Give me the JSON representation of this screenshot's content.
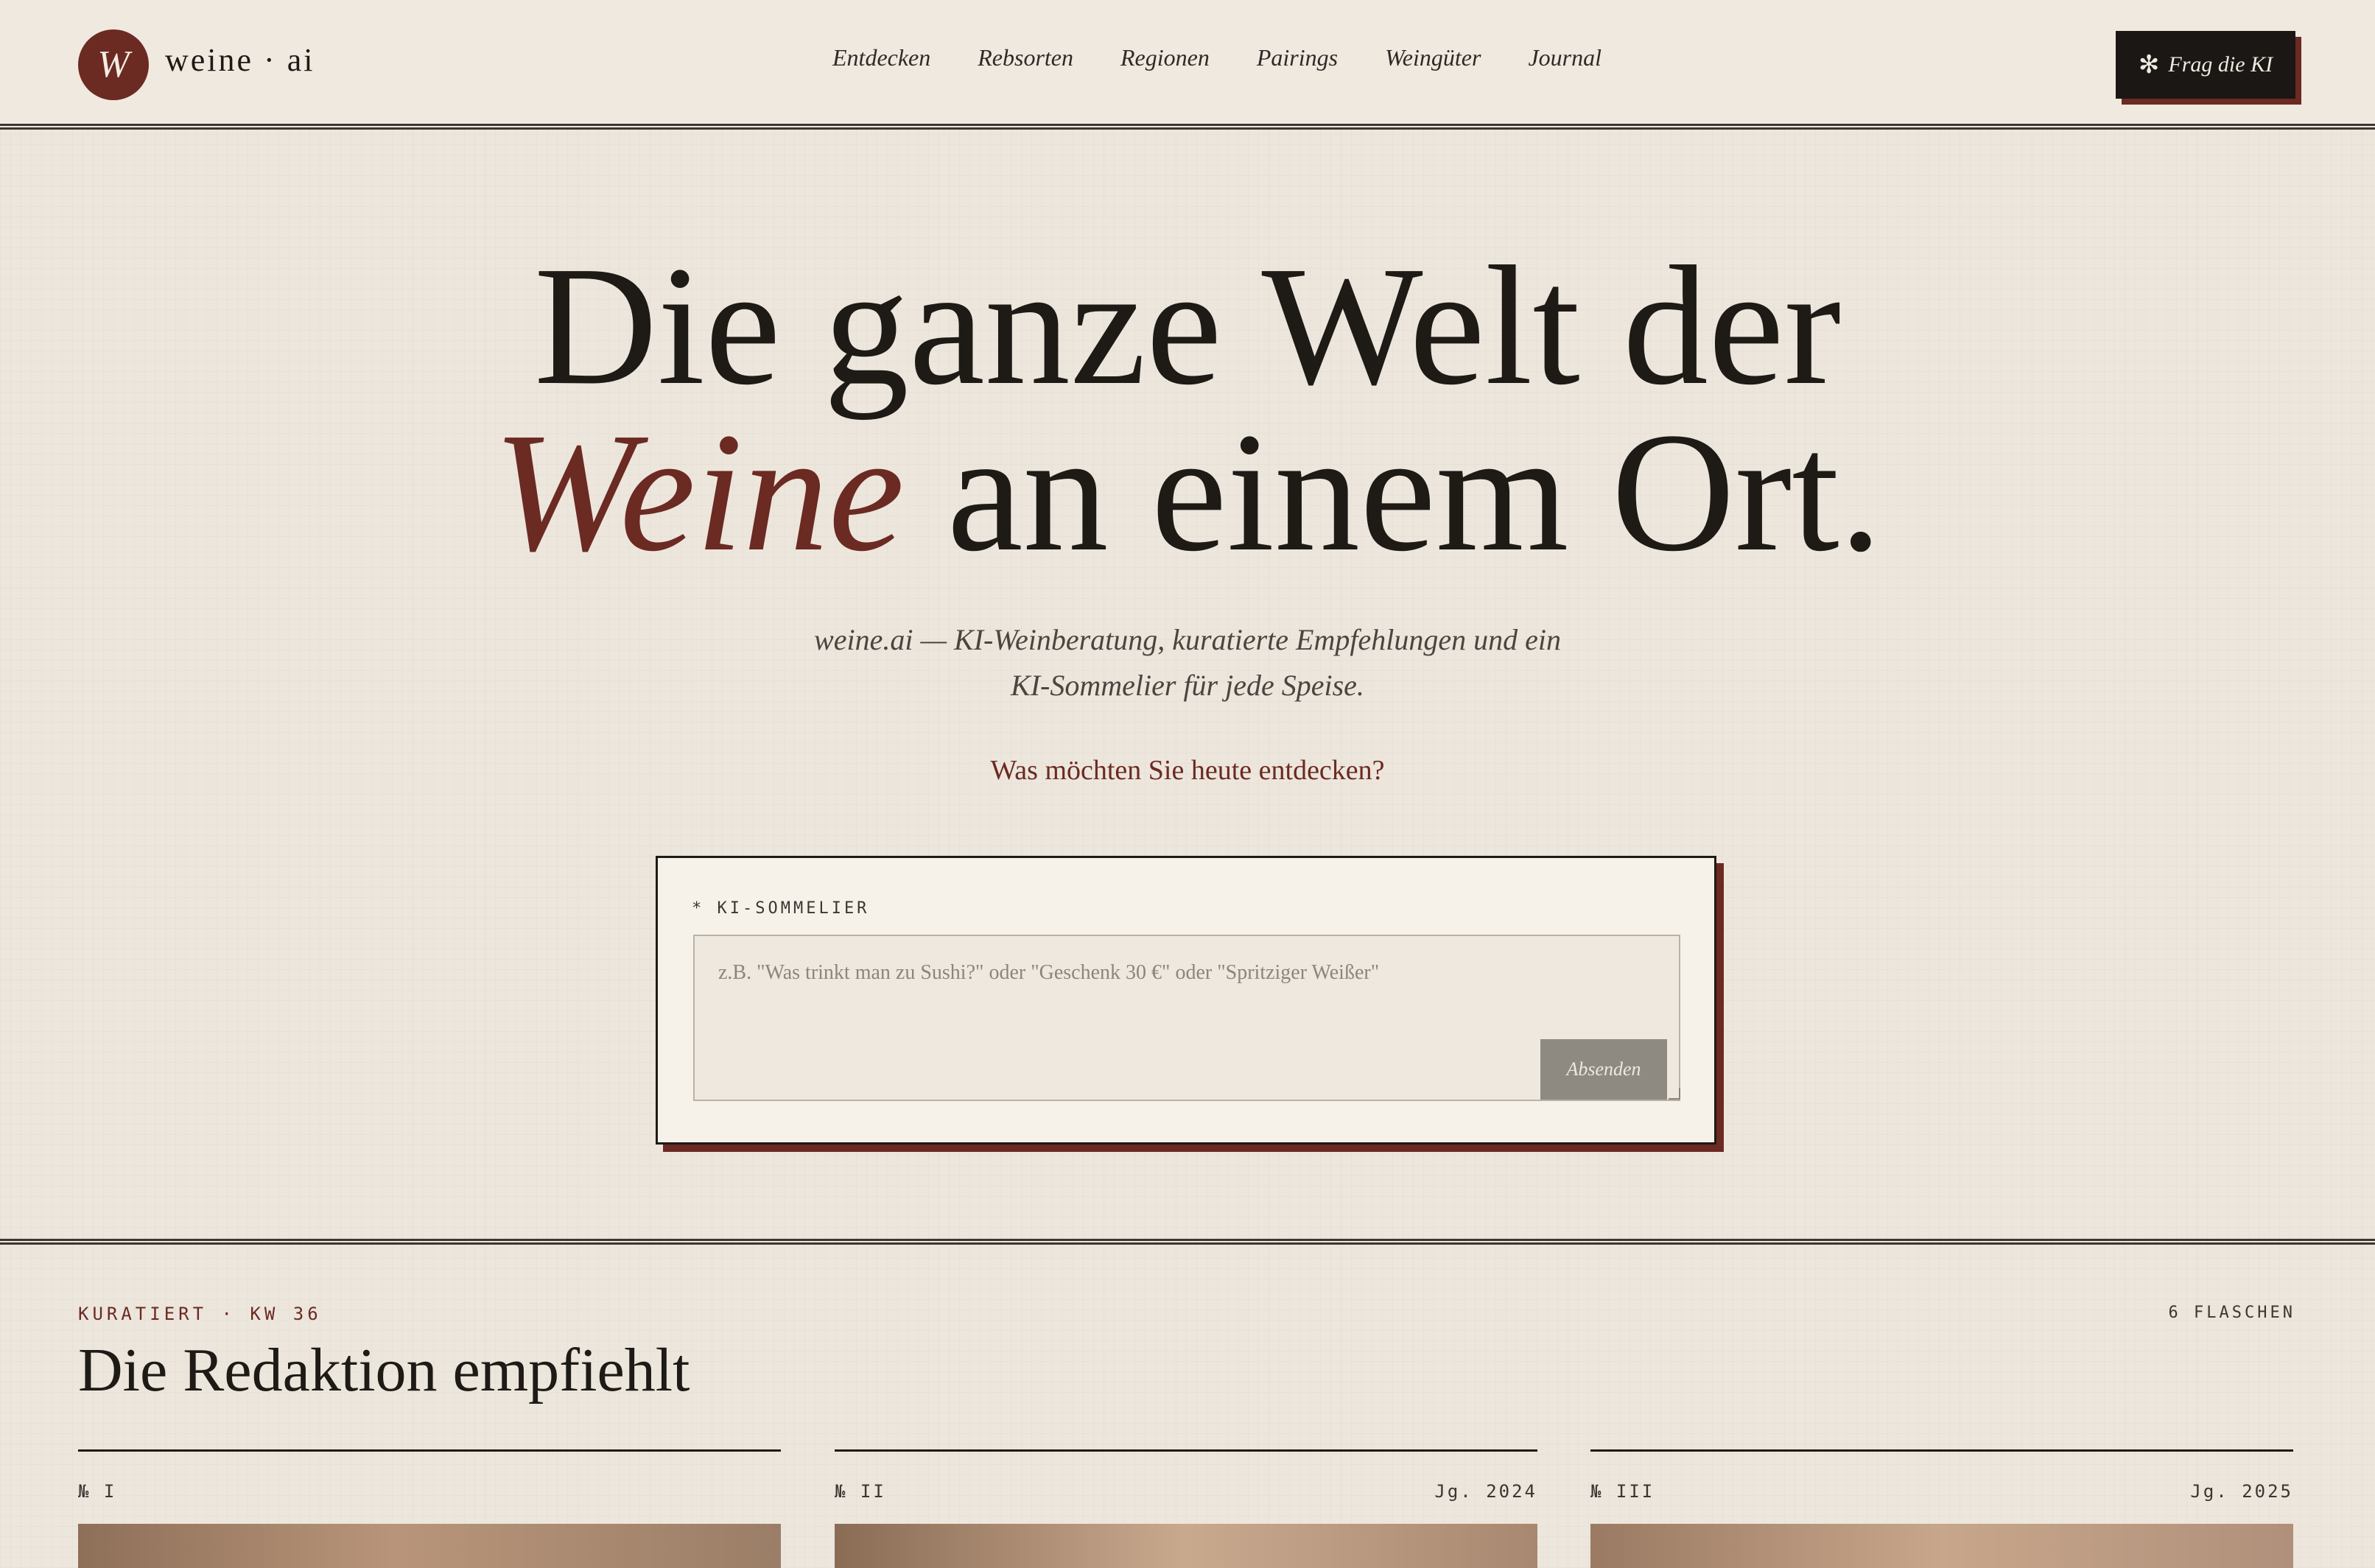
{
  "header": {
    "logo_letter": "W",
    "logo_text": "weine · ai",
    "nav": [
      "Entdecken",
      "Rebsorten",
      "Regionen",
      "Pairings",
      "Weingüter",
      "Journal"
    ],
    "cta_icon": "asterisk-icon",
    "cta_label": "Frag die KI"
  },
  "hero": {
    "title_line1": "Die ganze Welt der",
    "title_accent": "Weine",
    "title_line2_rest": " an einem Ort.",
    "subtitle_line1": "weine.ai — KI-Weinberatung, kuratierte Empfehlungen und ein",
    "subtitle_line2": "KI-Sommelier für jede Speise.",
    "question": "Was möchten Sie heute entdecken?"
  },
  "chat": {
    "label": "* KI-SOMMELIER",
    "placeholder": "z.B. \"Was trinkt man zu Sushi?\" oder \"Geschenk 30 €\" oder \"Spritziger Weißer\"",
    "value": "",
    "send_label": "Absenden"
  },
  "recommendations": {
    "kicker": "KURATIERT · KW 36",
    "count": "6 FLASCHEN",
    "title": "Die Redaktion empfiehlt",
    "cards": [
      {
        "number": "№ I",
        "vintage": ""
      },
      {
        "number": "№ II",
        "vintage": "Jg. 2024"
      },
      {
        "number": "№ III",
        "vintage": "Jg. 2025"
      }
    ]
  },
  "colors": {
    "background": "#ede6dc",
    "accent": "#6b2a22",
    "ink": "#1e1a16"
  }
}
